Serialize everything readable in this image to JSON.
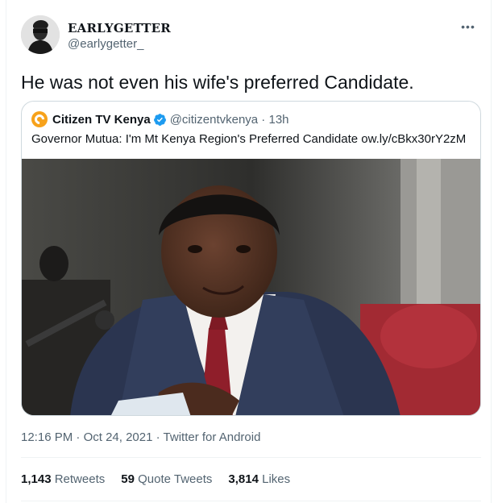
{
  "author": {
    "display_name": "EARLYGETTER",
    "handle": "@earlygetter_"
  },
  "tweet": {
    "text": "He was not even his wife's preferred Candidate.",
    "more_icon": "ellipsis-icon"
  },
  "quoted": {
    "display_name": "Citizen TV Kenya",
    "handle_time": "@citizentvkenya · 13h",
    "text": "Governor Mutua: I'm Mt Kenya Region's Preferred Candidate ow.ly/cBkx30rY2zM",
    "verified_color": "#1d9bf0",
    "logo_color": "#f7a21b"
  },
  "meta": {
    "time": "12:16 PM",
    "sep1": " · ",
    "date": "Oct 24, 2021",
    "sep2": " · ",
    "source": "Twitter for Android"
  },
  "stats": {
    "retweets_count": "1,143",
    "retweets_label": "Retweets",
    "quotes_count": "59",
    "quotes_label": "Quote Tweets",
    "likes_count": "3,814",
    "likes_label": "Likes"
  }
}
